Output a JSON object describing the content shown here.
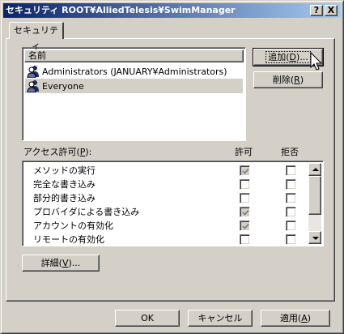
{
  "window": {
    "title": "セキュリティ ROOT¥AlliedTelesis¥SwimManager",
    "help_button": "?",
    "close_button": "X"
  },
  "tab": {
    "label": "セキュリティ"
  },
  "names_list": {
    "header": "名前",
    "items": [
      {
        "name": "Administrators (JANUARY¥Administrators)",
        "selected": false
      },
      {
        "name": "Everyone",
        "selected": true
      }
    ]
  },
  "buttons": {
    "add": {
      "text": "追加(",
      "key": "D",
      "tail": ")..."
    },
    "remove": {
      "text": "削除(",
      "key": "R",
      "tail": ")"
    },
    "advanced": {
      "text": "詳細(",
      "key": "V",
      "tail": ")..."
    },
    "ok": "OK",
    "cancel": "キャンセル",
    "apply": {
      "text": "適用(",
      "key": "A",
      "tail": ")"
    }
  },
  "permissions": {
    "label": "アクセス許可(",
    "label_key": "P",
    "label_tail": "):",
    "allow_header": "許可",
    "deny_header": "拒否",
    "rows": [
      {
        "name": "メソッドの実行",
        "allow": true,
        "allow_disabled": true,
        "deny": false
      },
      {
        "name": "完全な書き込み",
        "allow": false,
        "allow_disabled": false,
        "deny": false
      },
      {
        "name": "部分的書き込み",
        "allow": false,
        "allow_disabled": false,
        "deny": false
      },
      {
        "name": "プロバイダによる書き込み",
        "allow": true,
        "allow_disabled": true,
        "deny": false
      },
      {
        "name": "アカウントの有効化",
        "allow": true,
        "allow_disabled": true,
        "deny": false
      },
      {
        "name": "リモートの有効化",
        "allow": false,
        "allow_disabled": false,
        "deny": false
      }
    ]
  },
  "icons": {
    "user": "group-user-icon",
    "check": "checkmark-icon",
    "scroll_up": "scroll-up-arrow-icon",
    "scroll_down": "scroll-down-arrow-icon",
    "cursor": "mouse-pointer-icon"
  },
  "colors": {
    "title_start": "#0a246a",
    "title_end": "#a6caf0",
    "face": "#d4d0c8"
  }
}
